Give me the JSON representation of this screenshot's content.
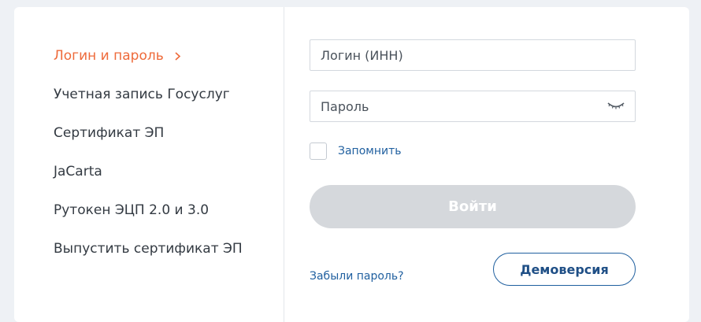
{
  "menu": {
    "items": [
      {
        "label": "Логин и пароль",
        "active": true
      },
      {
        "label": "Учетная запись Госуслуг",
        "active": false
      },
      {
        "label": "Сертификат ЭП",
        "active": false
      },
      {
        "label": "JaCarta",
        "active": false
      },
      {
        "label": "Рутокен ЭЦП 2.0 и 3.0",
        "active": false
      },
      {
        "label": "Выпустить сертификат ЭП",
        "active": false
      }
    ]
  },
  "form": {
    "login_placeholder": "Логин (ИНН)",
    "password_placeholder": "Пароль",
    "password_toggle_icon": "eye-closed-icon",
    "remember_label": "Запомнить",
    "remember_checked": false,
    "submit_label": "Войти",
    "submit_enabled": false,
    "forgot_label": "Забыли пароль?",
    "demo_label": "Демоверсия"
  },
  "colors": {
    "accent": "#ee6a3a",
    "link": "#1f5f9f",
    "disabled_button": "#d5d8dc"
  }
}
